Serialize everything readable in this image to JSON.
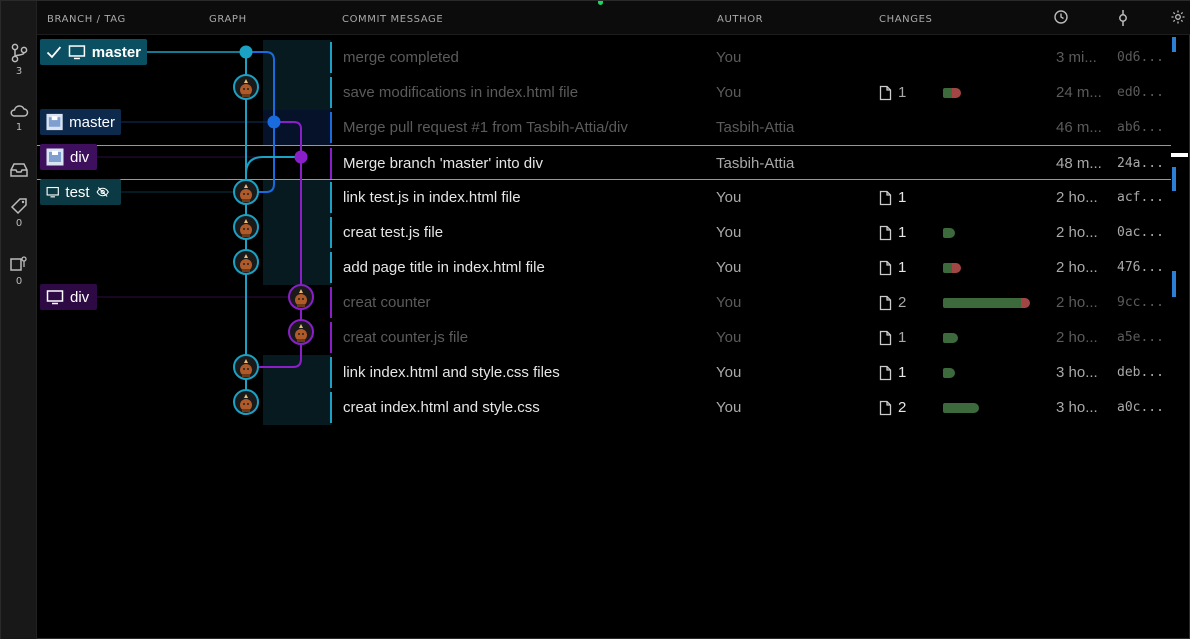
{
  "header": {
    "branch_tag": "BRANCH / TAG",
    "graph": "GRAPH",
    "commit_message": "COMMIT MESSAGE",
    "author": "AUTHOR",
    "changes": "CHANGES"
  },
  "activity": {
    "branches_count": "3",
    "remotes_count": "1",
    "stashes_count": "",
    "tags_count": "0",
    "worktrees_count": "0"
  },
  "refs": {
    "master_local": "master",
    "master_remote": "master",
    "div_remote": "div",
    "test_local": "test",
    "div_local": "div"
  },
  "commits": [
    {
      "message": "merge completed",
      "author": "You",
      "changes": "",
      "date": "3 mi...",
      "sha": "0d6..."
    },
    {
      "message": "save modifications in index.html file",
      "author": "You",
      "changes": "1",
      "date": "24 m...",
      "sha": "ed0..."
    },
    {
      "message": "Merge pull request #1 from Tasbih-Attia/div",
      "author": "Tasbih-Attia",
      "changes": "",
      "date": "46 m...",
      "sha": "ab6..."
    },
    {
      "message": "Merge branch 'master' into div",
      "author": "Tasbih-Attia",
      "changes": "",
      "date": "48 m...",
      "sha": "24a..."
    },
    {
      "message": "link test.js in index.html file",
      "author": "You",
      "changes": "1",
      "date": "2 ho...",
      "sha": "acf..."
    },
    {
      "message": "creat test.js file",
      "author": "You",
      "changes": "1",
      "date": "2 ho...",
      "sha": "0ac..."
    },
    {
      "message": "add page title in index.html file",
      "author": "You",
      "changes": "1",
      "date": "2 ho...",
      "sha": "476..."
    },
    {
      "message": "creat counter",
      "author": "You",
      "changes": "2",
      "date": "2 ho...",
      "sha": "9cc..."
    },
    {
      "message": "creat counter.js file",
      "author": "You",
      "changes": "1",
      "date": "2 ho...",
      "sha": "a5e..."
    },
    {
      "message": "link index.html and style.css files",
      "author": "You",
      "changes": "1",
      "date": "3 ho...",
      "sha": "deb..."
    },
    {
      "message": "creat index.html and style.css",
      "author": "You",
      "changes": "2",
      "date": "3 ho...",
      "sha": "a0c..."
    }
  ],
  "change_bars": [
    {
      "added": 0,
      "removed": 0
    },
    {
      "added": 0.3,
      "removed": 0.3
    },
    {
      "added": 0,
      "removed": 0
    },
    {
      "added": 0,
      "removed": 0
    },
    {
      "added": 0,
      "removed": 0
    },
    {
      "added": 0.4,
      "removed": 0
    },
    {
      "added": 0.3,
      "removed": 0.3
    },
    {
      "added": 2.6,
      "removed": 0.3
    },
    {
      "added": 0.5,
      "removed": 0
    },
    {
      "added": 0.4,
      "removed": 0
    },
    {
      "added": 1.2,
      "removed": 0
    }
  ],
  "colors": {
    "lane_master": "#1aa1c4",
    "lane_remote": "#1a6bde",
    "lane_div": "#8a1ec9",
    "selected_border": "#d88a3b",
    "added": "#3d6a3d",
    "removed": "#a24545"
  },
  "icons": {
    "branches": "source-control-icon",
    "remotes": "cloud-icon",
    "stashes": "inbox-icon",
    "tags": "tag-icon",
    "worktrees": "worktree-icon",
    "date_column": "clock-icon",
    "sha_column": "commit-icon",
    "settings": "gear-icon"
  }
}
